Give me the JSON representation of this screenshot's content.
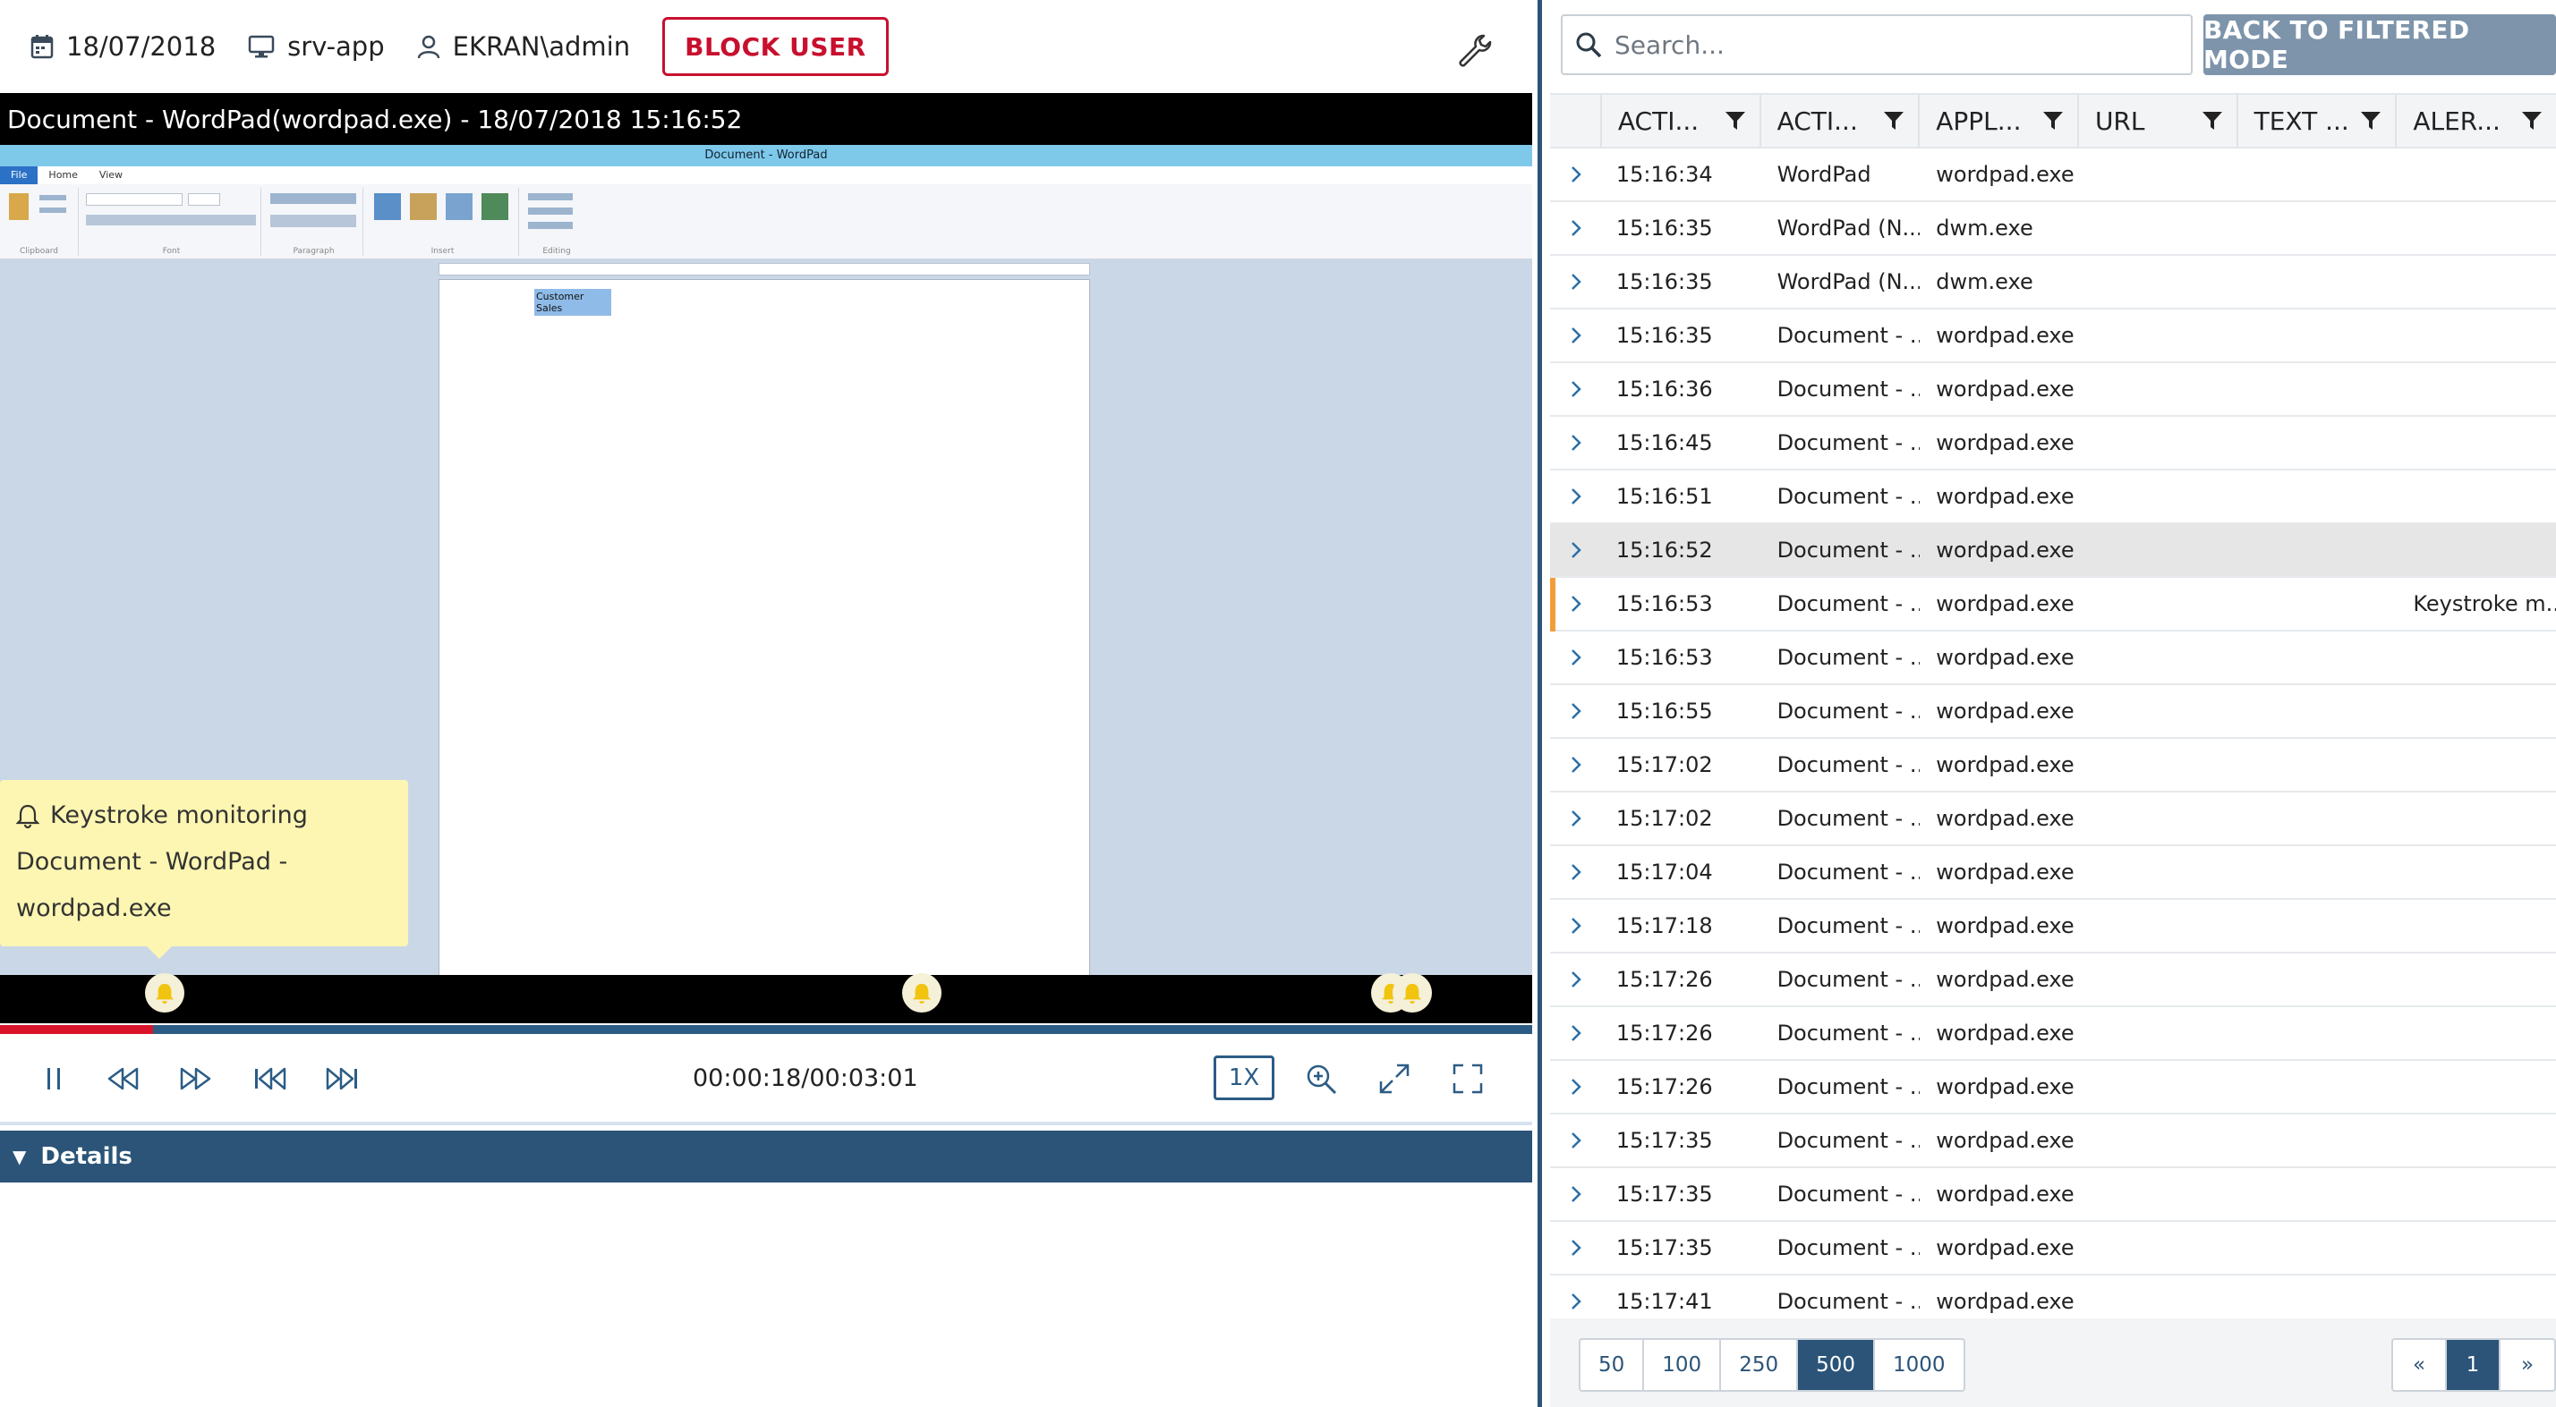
{
  "topbar": {
    "date": "18/07/2018",
    "host": "srv-app",
    "user": "EKRAN\\admin",
    "block_label": "BLOCK USER"
  },
  "player": {
    "title": "Document - WordPad(wordpad.exe) - 18/07/2018 15:16:52",
    "app_window_title": "Document - WordPad",
    "ribbon_tabs": [
      "File",
      "Home",
      "View"
    ],
    "ribbon_groups": [
      "Clipboard",
      "Font",
      "Paragraph",
      "Insert",
      "Editing"
    ],
    "document_text": "Customer Sales",
    "alert_tooltip": {
      "line1": "Keystroke monitoring",
      "line2": "Document - WordPad -",
      "line3": "wordpad.exe"
    },
    "progress_fraction": 0.1,
    "time": "00:00:18/00:03:01",
    "speed": "1X",
    "details_label": "Details"
  },
  "search": {
    "placeholder": "Search..."
  },
  "back_label": "BACK TO FILTERED MODE",
  "table": {
    "columns": [
      "ACTI...",
      "ACTI...",
      "APPL...",
      "URL",
      "TEXT ...",
      "ALER..."
    ],
    "rows": [
      {
        "time": "15:16:34",
        "activity": "WordPad",
        "app": "wordpad.exe",
        "alert": ""
      },
      {
        "time": "15:16:35",
        "activity": "WordPad (N...",
        "app": "dwm.exe",
        "alert": ""
      },
      {
        "time": "15:16:35",
        "activity": "WordPad (N...",
        "app": "dwm.exe",
        "alert": ""
      },
      {
        "time": "15:16:35",
        "activity": "Document - ...",
        "app": "wordpad.exe",
        "alert": ""
      },
      {
        "time": "15:16:36",
        "activity": "Document - ...",
        "app": "wordpad.exe",
        "alert": ""
      },
      {
        "time": "15:16:45",
        "activity": "Document - ...",
        "app": "wordpad.exe",
        "alert": ""
      },
      {
        "time": "15:16:51",
        "activity": "Document - ...",
        "app": "wordpad.exe",
        "alert": ""
      },
      {
        "time": "15:16:52",
        "activity": "Document - ...",
        "app": "wordpad.exe",
        "alert": ""
      },
      {
        "time": "15:16:53",
        "activity": "Document - ...",
        "app": "wordpad.exe",
        "alert": "Keystroke m..."
      },
      {
        "time": "15:16:53",
        "activity": "Document - ...",
        "app": "wordpad.exe",
        "alert": ""
      },
      {
        "time": "15:16:55",
        "activity": "Document - ...",
        "app": "wordpad.exe",
        "alert": ""
      },
      {
        "time": "15:17:02",
        "activity": "Document - ...",
        "app": "wordpad.exe",
        "alert": ""
      },
      {
        "time": "15:17:02",
        "activity": "Document - ...",
        "app": "wordpad.exe",
        "alert": ""
      },
      {
        "time": "15:17:04",
        "activity": "Document - ...",
        "app": "wordpad.exe",
        "alert": ""
      },
      {
        "time": "15:17:18",
        "activity": "Document - ...",
        "app": "wordpad.exe",
        "alert": ""
      },
      {
        "time": "15:17:26",
        "activity": "Document - ...",
        "app": "wordpad.exe",
        "alert": ""
      },
      {
        "time": "15:17:26",
        "activity": "Document - ...",
        "app": "wordpad.exe",
        "alert": ""
      },
      {
        "time": "15:17:26",
        "activity": "Document - ...",
        "app": "wordpad.exe",
        "alert": ""
      },
      {
        "time": "15:17:35",
        "activity": "Document - ...",
        "app": "wordpad.exe",
        "alert": ""
      },
      {
        "time": "15:17:35",
        "activity": "Document - ...",
        "app": "wordpad.exe",
        "alert": ""
      },
      {
        "time": "15:17:35",
        "activity": "Document - ...",
        "app": "wordpad.exe",
        "alert": ""
      },
      {
        "time": "15:17:41",
        "activity": "Document - ...",
        "app": "wordpad.exe",
        "alert": ""
      }
    ],
    "selected_row_index": 7,
    "alert_row_index": 8
  },
  "pagination": {
    "page_sizes": [
      "50",
      "100",
      "250",
      "500",
      "1000"
    ],
    "active_page_size": "500",
    "first": "«",
    "current_page": "1",
    "last": "»"
  },
  "colors": {
    "accent": "#2b5478",
    "block_red": "#c8102e",
    "alert_orange": "#f39c3a",
    "tooltip_yellow": "#fdf6b2"
  }
}
